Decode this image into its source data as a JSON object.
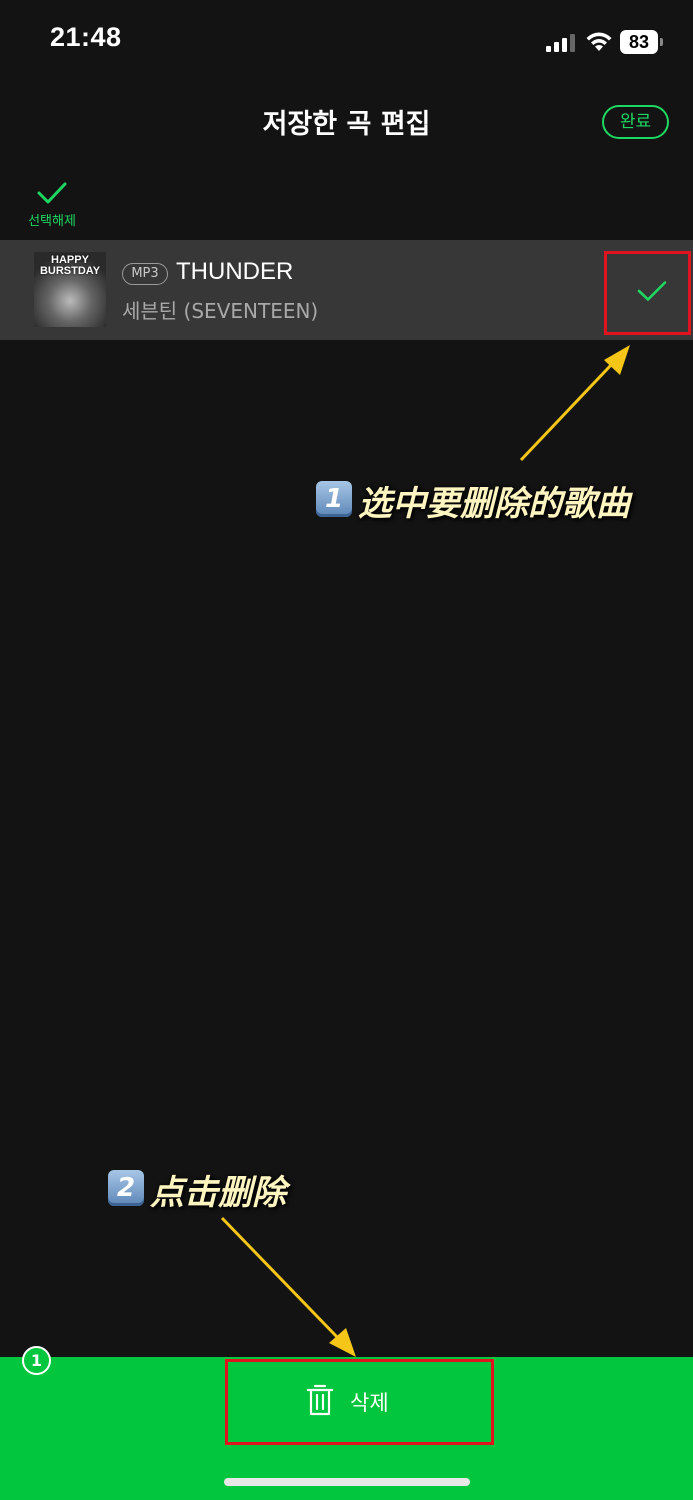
{
  "status_bar": {
    "time": "21:48",
    "battery": "83"
  },
  "header": {
    "title": "저장한 곡 편집",
    "done_label": "완료"
  },
  "selection": {
    "deselect_all_label": "선택해제",
    "selected_count": "1"
  },
  "songs": [
    {
      "album_art_text": "HAPPY BURSTDAY",
      "badge": "MP3",
      "title": "THUNDER",
      "artist": "세븐틴 (SEVENTEEN)",
      "selected": true
    }
  ],
  "bottom_bar": {
    "delete_label": "삭제"
  },
  "annotations": [
    {
      "number": "1",
      "text": "选中要删除的歌曲"
    },
    {
      "number": "2",
      "text": "点击删除"
    }
  ],
  "colors": {
    "accent": "#1ed760",
    "bottom_bar": "#02c63d",
    "background": "#131313",
    "row_background": "#373737",
    "highlight_box": "#e0141e",
    "annotation_arrow": "#f5c518"
  },
  "icons": [
    "cellular-signal-icon",
    "wifi-icon",
    "battery-icon",
    "checkmark-icon",
    "trash-icon"
  ]
}
